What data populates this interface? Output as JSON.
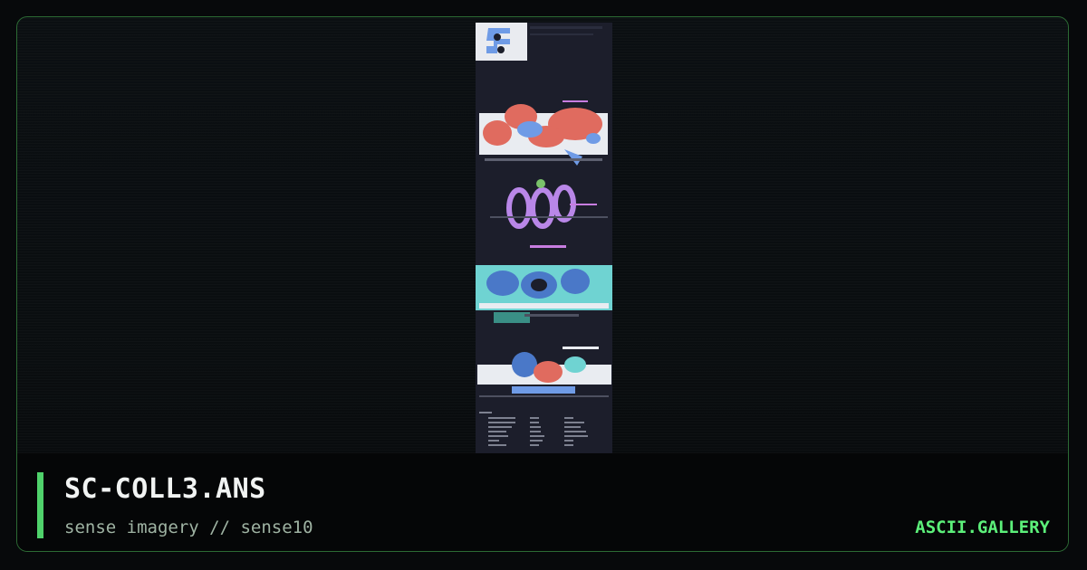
{
  "artwork": {
    "title": "SC-COLL3.ANS",
    "subtitle": "sense imagery // sense10"
  },
  "brand": {
    "name": "ASCII.GALLERY"
  },
  "colors": {
    "frame_border": "#2c6a34",
    "accent_bar": "#4fd26b",
    "brand_text": "#5cf07a",
    "art_background": "#1b1d2a"
  },
  "preview": {
    "description_icon": "ansi-art-thumbnail"
  }
}
